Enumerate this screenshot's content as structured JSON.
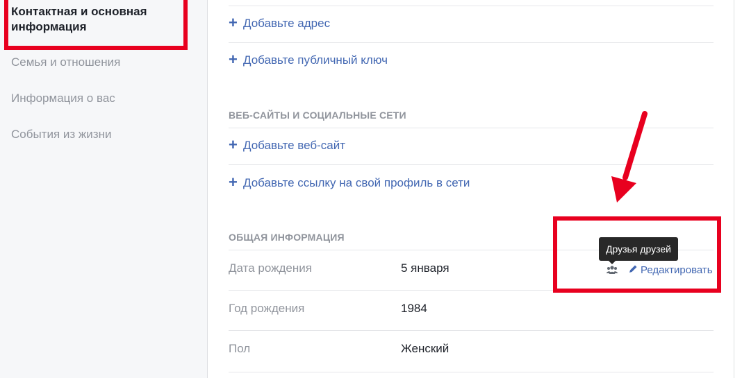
{
  "sidebar": {
    "active": "Контактная и основная информация",
    "items": [
      {
        "label": "Семья и отношения"
      },
      {
        "label": "Информация о вас"
      },
      {
        "label": "События из жизни"
      }
    ]
  },
  "contact": {
    "add_address": "Добавьте адрес",
    "add_public_key": "Добавьте публичный ключ"
  },
  "websites": {
    "title": "ВЕБ-САЙТЫ И СОЦИАЛЬНЫЕ СЕТИ",
    "add_website": "Добавьте веб-сайт",
    "add_profile_link": "Добавьте ссылку на свой профиль в сети"
  },
  "general": {
    "title": "ОБЩАЯ ИНФОРМАЦИЯ",
    "rows": [
      {
        "label": "Дата рождения",
        "value": "5 января"
      },
      {
        "label": "Год рождения",
        "value": "1984"
      },
      {
        "label": "Пол",
        "value": "Женский"
      }
    ],
    "tooltip": "Друзья друзей",
    "edit_label": "Редактировать"
  },
  "annotation_color": "#e8001f",
  "icons": {
    "plus": "plus-icon",
    "audience": "friends-of-friends-icon",
    "edit": "pencil-icon"
  }
}
